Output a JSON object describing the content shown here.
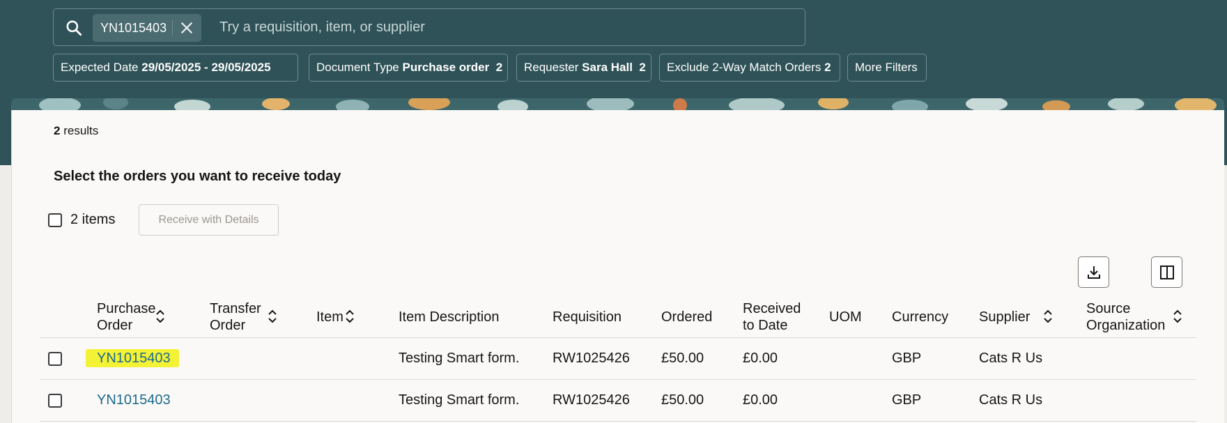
{
  "search": {
    "chip_value": "YN1015403",
    "placeholder": "Try a requisition, item, or supplier"
  },
  "filters": [
    {
      "label": "Expected Date",
      "value": "29/05/2025 - 29/05/2025",
      "count": ""
    },
    {
      "label": "Document Type",
      "value": "Purchase order",
      "count": "2"
    },
    {
      "label": "Requester",
      "value": "Sara Hall",
      "count": "2"
    },
    {
      "label": "Exclude 2-Way Match Orders",
      "value": "",
      "count": "2"
    },
    {
      "label": "More Filters",
      "value": "",
      "count": ""
    }
  ],
  "results": {
    "count": "2",
    "label": "results"
  },
  "heading": "Select the orders you want to receive today",
  "selection": {
    "items_label": "2 items",
    "receive_button": "Receive with Details"
  },
  "table": {
    "columns": {
      "purchase_order": [
        "Purchase",
        "Order"
      ],
      "transfer_order": [
        "Transfer",
        "Order"
      ],
      "item": "Item",
      "item_description": "Item Description",
      "requisition": "Requisition",
      "ordered": "Ordered",
      "received_to_date": [
        "Received",
        "to Date"
      ],
      "uom": "UOM",
      "currency": "Currency",
      "supplier": "Supplier",
      "source_organization": [
        "Source",
        "Organization"
      ]
    },
    "rows": [
      {
        "purchase_order": "YN1015403",
        "transfer_order": "",
        "item": "",
        "item_description": "Testing Smart form.",
        "requisition": "RW1025426",
        "ordered": "£50.00",
        "received_to_date": "£0.00",
        "uom": "",
        "currency": "GBP",
        "supplier": "Cats R Us",
        "source_organization": "",
        "highlighted": true
      },
      {
        "purchase_order": "YN1015403",
        "transfer_order": "",
        "item": "",
        "item_description": "Testing Smart form.",
        "requisition": "RW1025426",
        "ordered": "£50.00",
        "received_to_date": "£0.00",
        "uom": "",
        "currency": "GBP",
        "supplier": "Cats R Us",
        "source_organization": "",
        "highlighted": false
      }
    ]
  },
  "colors": {
    "header_bg": "#2f5359",
    "link": "#1e6a8a",
    "highlight": "#f4f235"
  },
  "icons": [
    "search-icon",
    "close-icon",
    "download-icon",
    "columns-icon",
    "sort-icon"
  ]
}
